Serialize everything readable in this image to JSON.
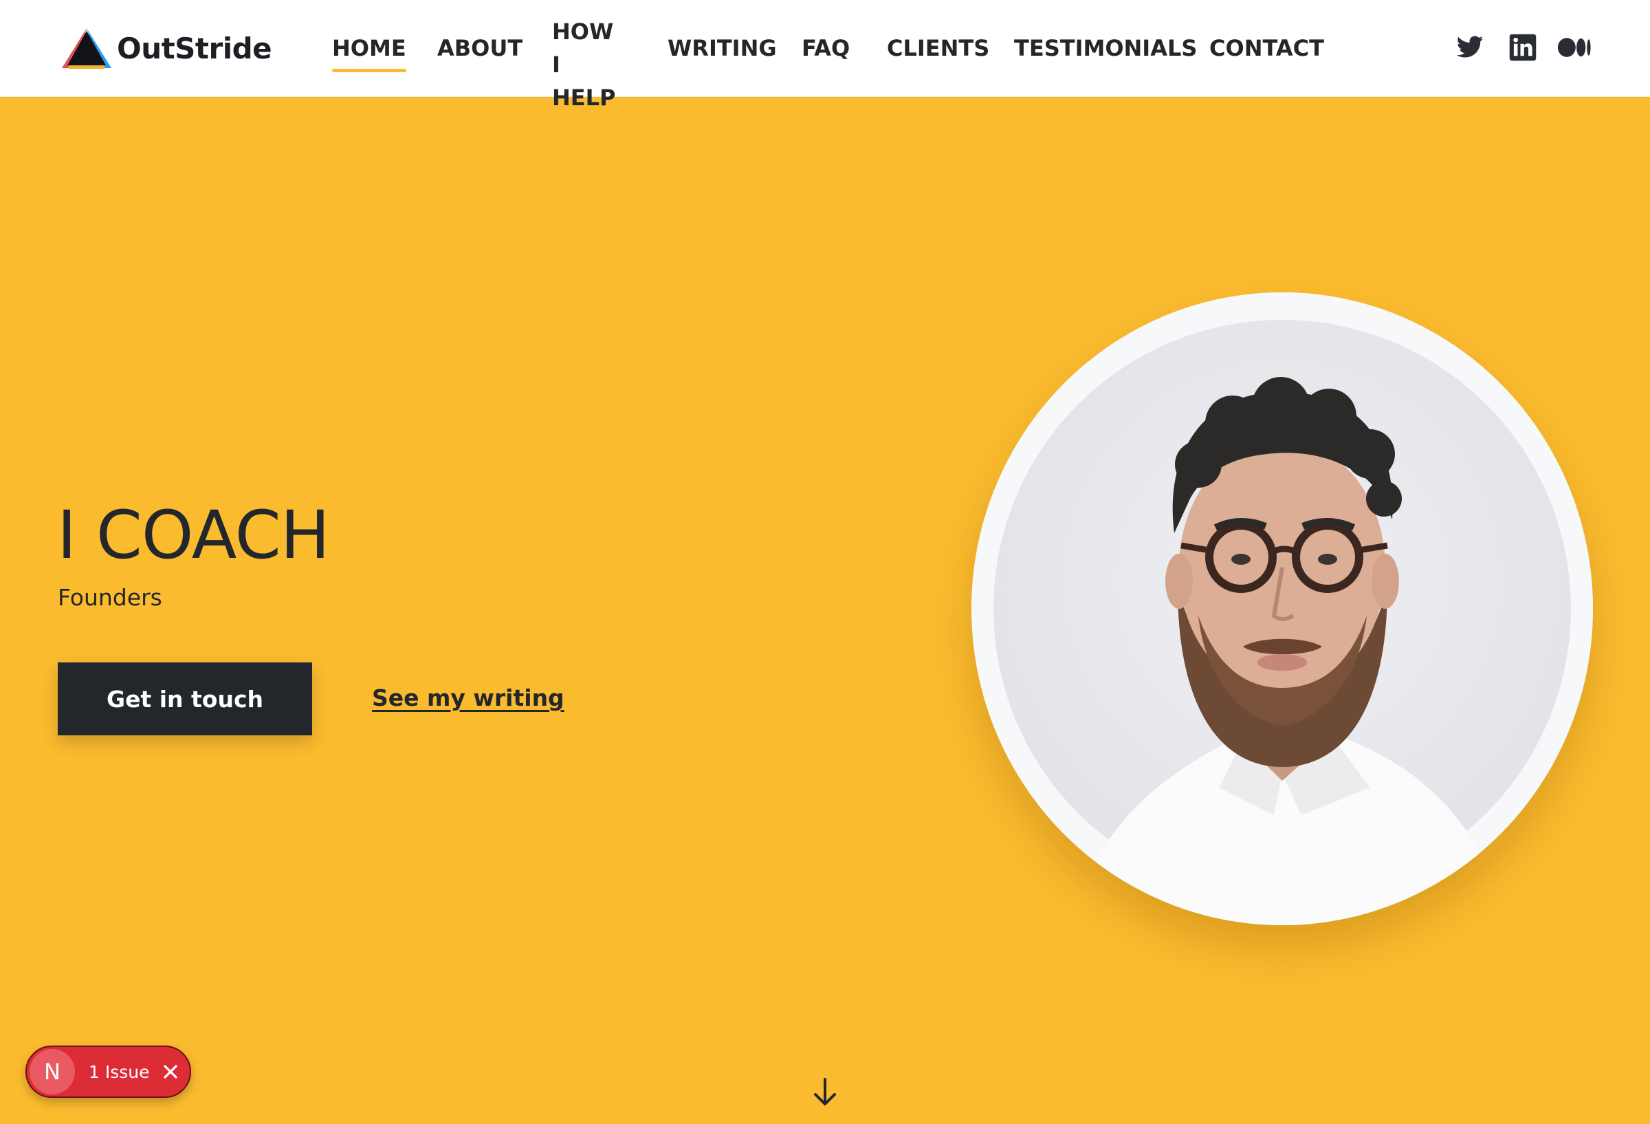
{
  "header": {
    "logo_text": "OutStride",
    "nav": [
      {
        "label": "HOME",
        "active": true
      },
      {
        "label": "ABOUT"
      },
      {
        "label": "HOW I HELP"
      },
      {
        "label": "WRITING"
      },
      {
        "label": "FAQ"
      },
      {
        "label": "CLIENTS"
      },
      {
        "label": "TESTIMONIALS"
      },
      {
        "label": "CONTACT"
      }
    ],
    "social": [
      "twitter-icon",
      "linkedin-icon",
      "medium-icon"
    ]
  },
  "hero": {
    "title": "I COACH",
    "subtitle": "Founders",
    "primary_button": "Get in touch",
    "secondary_link": "See my writing"
  },
  "issue_badge": {
    "letter": "N",
    "text": "1 Issue"
  },
  "colors": {
    "accent_yellow": "#fbbb2f",
    "dark": "#23262b",
    "issue_red": "#dc2d37"
  }
}
